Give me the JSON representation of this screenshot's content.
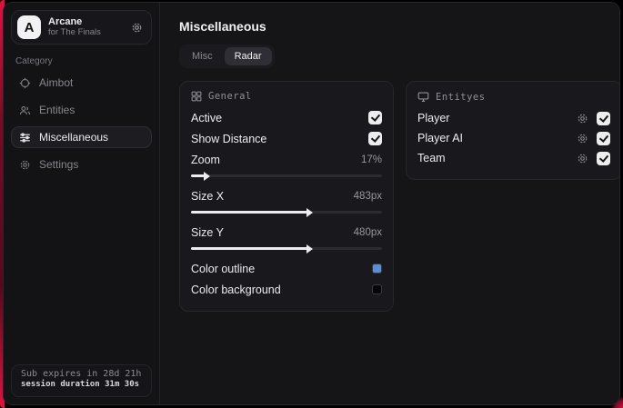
{
  "sidebar": {
    "profile": {
      "initial": "A",
      "name": "Arcane",
      "subtitle": "for The Finals"
    },
    "category_label": "Category",
    "items": [
      {
        "label": "Aimbot",
        "icon": "crosshair-icon"
      },
      {
        "label": "Entities",
        "icon": "users-icon"
      },
      {
        "label": "Miscellaneous",
        "icon": "sliders-icon"
      },
      {
        "label": "Settings",
        "icon": "gear-icon"
      }
    ],
    "status": {
      "line1": "Sub expires in 28d 21h",
      "line2": "session duration 31m 30s"
    }
  },
  "main": {
    "title": "Miscellaneous",
    "tabs": [
      {
        "label": "Misc"
      },
      {
        "label": "Radar"
      }
    ],
    "active_tab": "Radar"
  },
  "general": {
    "header": "General",
    "toggles": [
      {
        "label": "Active",
        "checked": true
      },
      {
        "label": "Show Distance",
        "checked": true
      }
    ],
    "sliders": [
      {
        "label": "Zoom",
        "value": "17%",
        "fill_pct": 7
      },
      {
        "label": "Size X",
        "value": "483px",
        "fill_pct": 61
      },
      {
        "label": "Size Y",
        "value": "480px",
        "fill_pct": 61
      }
    ],
    "colors": [
      {
        "label": "Color outline",
        "value": "#5b8ed6"
      },
      {
        "label": "Color background",
        "value": "#050505"
      }
    ]
  },
  "entities": {
    "header": "Entityes",
    "rows": [
      {
        "label": "Player",
        "checked": true
      },
      {
        "label": "Player AI",
        "checked": true
      },
      {
        "label": "Team",
        "checked": true
      }
    ]
  },
  "colors": {
    "accent_red": "#dd1540",
    "swatch_blue": "#5b8ed6"
  }
}
